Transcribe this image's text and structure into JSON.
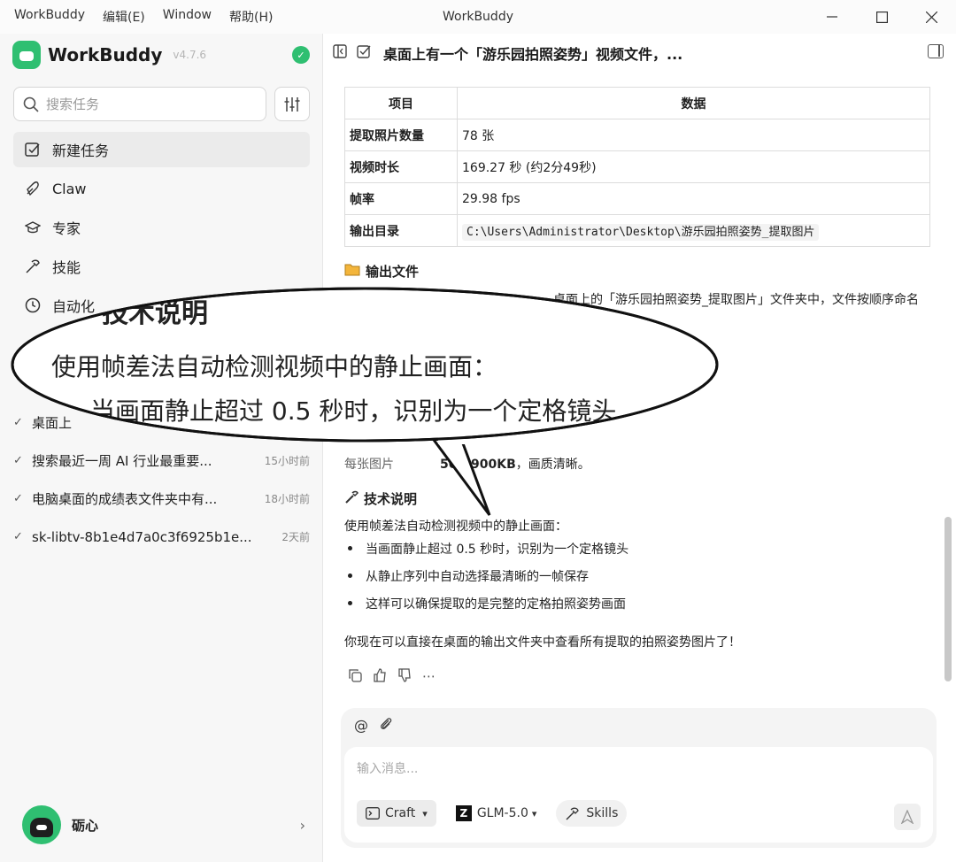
{
  "titlebar": {
    "menu": [
      "WorkBuddy",
      "编辑(E)",
      "Window",
      "帮助(H)"
    ],
    "title": "WorkBuddy"
  },
  "sidebar": {
    "brand": "WorkBuddy",
    "version": "v4.7.6",
    "search_placeholder": "搜索任务",
    "nav": [
      {
        "label": "新建任务",
        "icon": "new-task-icon",
        "active": true
      },
      {
        "label": "Claw",
        "icon": "claw-icon"
      },
      {
        "label": "专家",
        "icon": "expert-icon"
      },
      {
        "label": "技能",
        "icon": "skills-icon"
      },
      {
        "label": "自动化",
        "icon": "clock-icon"
      }
    ],
    "history": [
      {
        "title": "桌面上",
        "time": ""
      },
      {
        "title": "搜索最近一周 AI 行业最重要...",
        "time": "15小时前"
      },
      {
        "title": "电脑桌面的成绩表文件夹中有...",
        "time": "18小时前"
      },
      {
        "title": "sk-libtv-8b1e4d7a0c3f6925b1e...",
        "time": "2天前"
      }
    ],
    "user": "砺心"
  },
  "main": {
    "title": "桌面上有一个「游乐园拍照姿势」视频文件，...",
    "table": {
      "headers": [
        "项目",
        "数据"
      ],
      "rows": [
        [
          "提取照片数量",
          "78 张"
        ],
        [
          "视频时长",
          "169.27 秒 (约2分49秒)"
        ],
        [
          "帧率",
          "29.98 fps"
        ],
        [
          "输出目录",
          "C:\\Users\\Administrator\\Desktop\\游乐园拍照姿势_提取图片"
        ]
      ]
    },
    "output_heading": "输出文件",
    "output_text": "桌面上的「游乐园拍照姿势_提取图片」文件夹中，文件按顺序命名",
    "size_text_prefix": "每张图片",
    "size_text_bold": "500-900KB",
    "size_text_suffix": "，画质清晰。",
    "tech_heading": "技术说明",
    "tech_intro": "使用帧差法自动检测视频中的静止画面：",
    "tech_bullets": [
      "当画面静止超过 0.5 秒时，识别为一个定格镜头",
      "从静止序列中自动选择最清晰的一帧保存",
      "这样可以确保提取的是完整的定格拍照姿势画面"
    ],
    "closing": "你现在可以直接在桌面的输出文件夹中查看所有提取的拍照姿势图片了！"
  },
  "composer": {
    "placeholder": "输入消息...",
    "mode": "Craft",
    "model": "GLM-5.0",
    "skills": "Skills"
  },
  "callout": {
    "heading": "技术说明",
    "intro": "使用帧差法自动检测视频中的静止画面：",
    "bullet": "当画面静止超过 0.5 秒时，识别为一个定格镜头",
    "partial": "从静止序列中自动选择最清晰的一帧"
  }
}
